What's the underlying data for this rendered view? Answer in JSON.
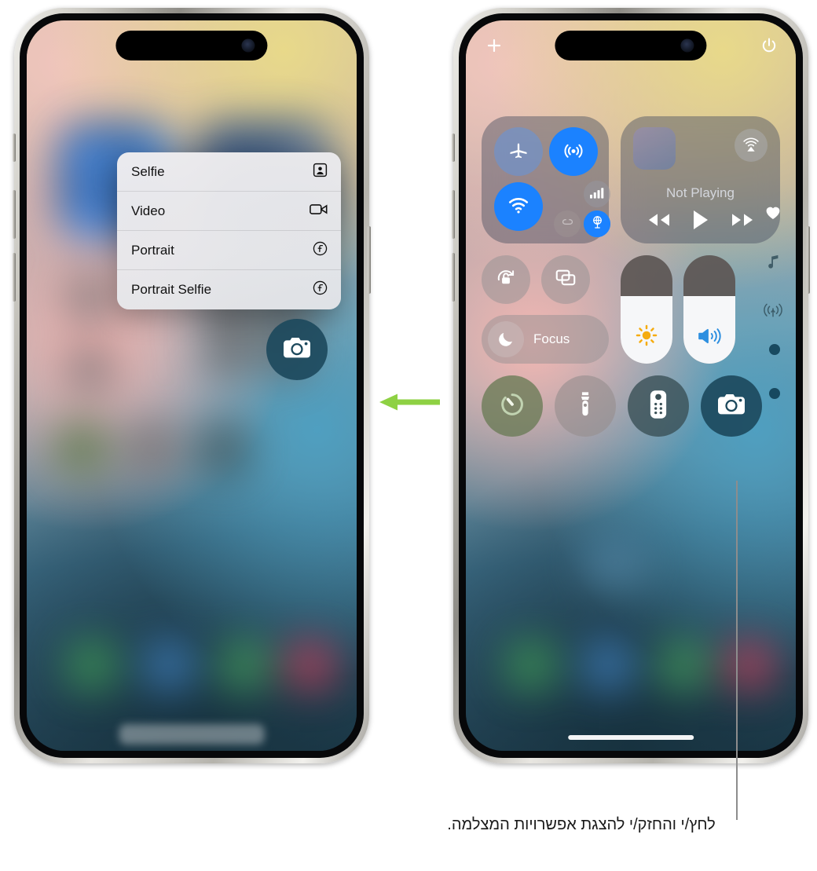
{
  "figure": {
    "caption": "לחץ/י והחזק/י להצגת אפשרויות המצלמה.",
    "arrow_color": "#8ed143",
    "callout_color": "#8d8d8d"
  },
  "left_phone": {
    "context_menu": {
      "items": [
        {
          "label": "Selfie",
          "icon": "selfie-icon"
        },
        {
          "label": "Video",
          "icon": "video-camera-icon"
        },
        {
          "label": "Portrait",
          "icon": "aperture-f-icon"
        },
        {
          "label": "Portrait Selfie",
          "icon": "aperture-f-icon"
        }
      ]
    },
    "camera_button": {
      "icon": "camera-icon",
      "label": "Camera"
    }
  },
  "right_phone": {
    "status": {
      "add_icon": "plus-icon",
      "power_icon": "power-icon"
    },
    "connectivity": {
      "airplane": {
        "label": "Airplane Mode",
        "icon": "airplane-icon",
        "state": "off",
        "color": "#5a93dd"
      },
      "airdrop": {
        "label": "AirDrop",
        "icon": "airdrop-icon",
        "state": "on",
        "color": "#1b82ff"
      },
      "wifi": {
        "label": "Wi-Fi",
        "icon": "wifi-icon",
        "state": "on",
        "color": "#1b82ff"
      },
      "cellular": {
        "label": "Cellular Data",
        "icon": "cellular-bars-icon",
        "state": "off"
      },
      "bluetooth": {
        "label": "Bluetooth",
        "icon": "bluetooth-icon",
        "state": "on",
        "color": "#1b82ff"
      },
      "satellite": {
        "label": "AirDrop Share",
        "icon": "airdrop-share-icon",
        "state": "off"
      },
      "hotspot": {
        "label": "Personal Hotspot",
        "icon": "globe-vpn-icon",
        "state": "on",
        "color": "#1b82ff"
      }
    },
    "media": {
      "title": "Not Playing",
      "airplay_icon": "airplay-audio-icon",
      "rewind_icon": "rewind-icon",
      "play_icon": "play-icon",
      "forward_icon": "fast-forward-icon"
    },
    "toggles": {
      "rotation_lock": {
        "label": "Rotation Lock",
        "icon": "rotation-lock-icon"
      },
      "mirroring": {
        "label": "Screen Mirroring",
        "icon": "screen-mirroring-icon"
      },
      "focus": {
        "label": "Focus",
        "icon": "moon-icon"
      }
    },
    "sliders": {
      "brightness": {
        "label": "Brightness",
        "icon": "sun-icon",
        "value": 62,
        "color": "#f5ac10"
      },
      "volume": {
        "label": "Volume",
        "icon": "speaker-icon",
        "value": 62,
        "color": "#2d8fe0"
      }
    },
    "bottom_controls": [
      {
        "label": "Timer",
        "icon": "timer-icon"
      },
      {
        "label": "Flashlight",
        "icon": "flashlight-icon"
      },
      {
        "label": "Remote",
        "icon": "apple-tv-remote-icon"
      },
      {
        "label": "Camera",
        "icon": "camera-icon"
      }
    ],
    "side_rail": [
      {
        "label": "Favorites",
        "icon": "heart-icon"
      },
      {
        "label": "Now Playing",
        "icon": "music-note-icon"
      },
      {
        "label": "Connectivity",
        "icon": "broadcast-icon"
      }
    ],
    "page_dots": 2,
    "home_indicator": true
  }
}
